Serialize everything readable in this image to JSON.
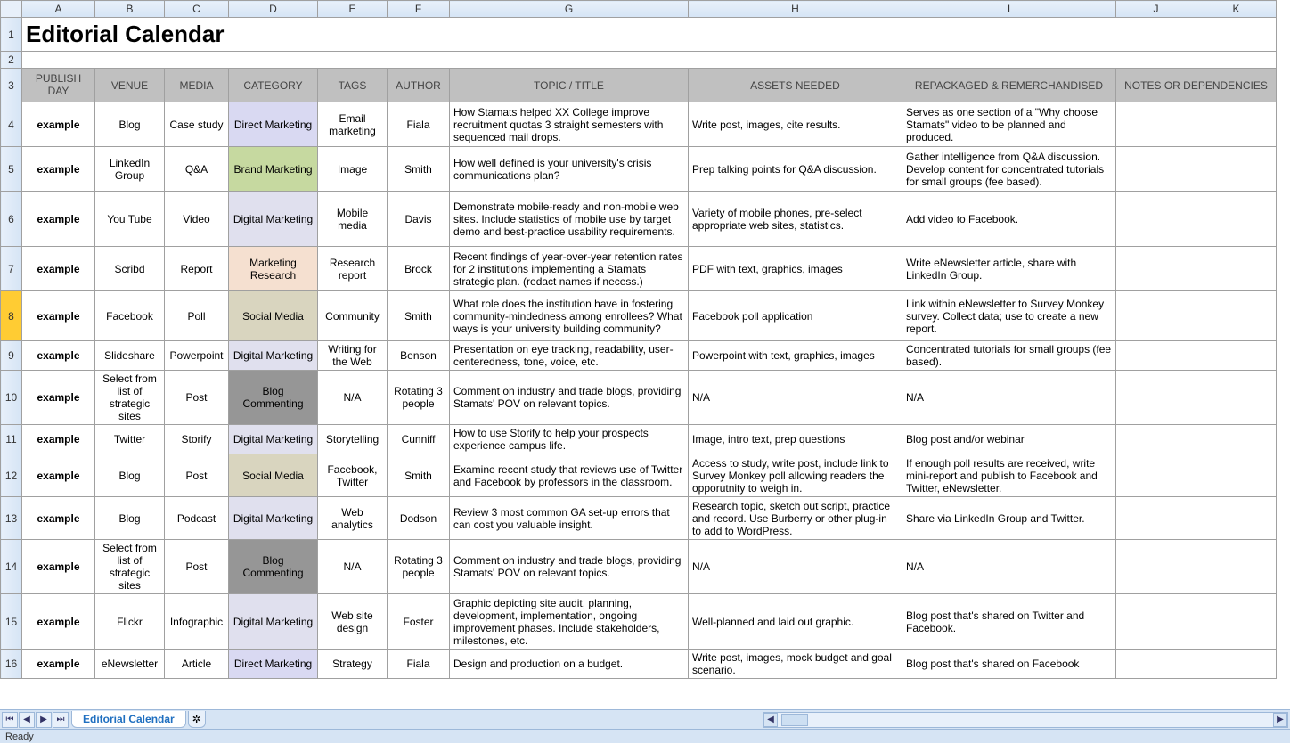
{
  "title": "Editorial Calendar",
  "col_letters": [
    "A",
    "B",
    "C",
    "D",
    "E",
    "F",
    "G",
    "H",
    "I",
    "J",
    "K"
  ],
  "row_numbers": [
    "1",
    "2",
    "3",
    "4",
    "5",
    "6",
    "7",
    "8",
    "9",
    "10",
    "11",
    "12",
    "13",
    "14",
    "15",
    "16"
  ],
  "headers": {
    "publish_day": "PUBLISH DAY",
    "venue": "VENUE",
    "media": "MEDIA",
    "category": "CATEGORY",
    "tags": "TAGS",
    "author": "AUTHOR",
    "topic": "TOPIC / TITLE",
    "assets": "ASSETS NEEDED",
    "repack": "REPACKAGED & REMERCHANDISED",
    "notes": "NOTES OR DEPENDENCIES"
  },
  "rows": [
    {
      "day": "example",
      "venue": "Blog",
      "media": "Case study",
      "category": "Direct Marketing",
      "catclass": "c-direct",
      "tags": "Email marketing",
      "author": "Fiala",
      "topic": "How Stamats helped XX College improve recruitment quotas 3 straight semesters with sequenced mail drops.",
      "assets": "Write post, images, cite results.",
      "repack": "Serves as one section of a \"Why choose Stamats\" video to be planned and produced.",
      "notes": "",
      "rh": "row-h4"
    },
    {
      "day": "example",
      "venue": "LinkedIn Group",
      "media": "Q&A",
      "category": "Brand Marketing",
      "catclass": "c-brand",
      "tags": "Image",
      "author": "Smith",
      "topic": "How well defined is your university's crisis communications plan?",
      "assets": "Prep talking points for Q&A discussion.",
      "repack": "Gather intelligence from Q&A discussion. Develop content for concentrated tutorials for small groups (fee based).",
      "notes": "",
      "rh": "row-h4"
    },
    {
      "day": "example",
      "venue": "You Tube",
      "media": "Video",
      "category": "Digital Marketing",
      "catclass": "c-digital",
      "tags": "Mobile media",
      "author": "Davis",
      "topic": "Demonstrate mobile-ready and non-mobile web sites. Include statistics of mobile use by target demo and best-practice usability requirements.",
      "assets": "Variety of mobile phones, pre-select appropriate web sites, statistics.",
      "repack": "Add video to Facebook.",
      "notes": "",
      "rh": "row-h5"
    },
    {
      "day": "example",
      "venue": "Scribd",
      "media": "Report",
      "category": "Marketing Research",
      "catclass": "c-research",
      "tags": "Research report",
      "author": "Brock",
      "topic": "Recent findings of year-over-year retention rates for 2 institutions implementing a Stamats strategic plan. (redact names if necess.)",
      "assets": "PDF with text, graphics, images",
      "repack": "Write eNewsletter article, share with LinkedIn Group.",
      "notes": "",
      "rh": "row-h4"
    },
    {
      "day": "example",
      "venue": "Facebook",
      "media": "Poll",
      "category": "Social Media",
      "catclass": "c-social",
      "tags": "Community",
      "author": "Smith",
      "topic": "What role does the institution have in fostering community-mindedness among enrollees? What ways is your university building community?",
      "assets": "Facebook poll application",
      "repack": "Link within eNewsletter to Survey Monkey survey. Collect data; use to create a new report.",
      "notes": "",
      "rh": "row-h6"
    },
    {
      "day": "example",
      "venue": "Slideshare",
      "media": "Powerpoint",
      "category": "Digital Marketing",
      "catclass": "c-digital",
      "tags": "Writing for the Web",
      "author": "Benson",
      "topic": "Presentation on eye tracking, readability, user-centeredness, tone, voice, etc.",
      "assets": "Powerpoint with text, graphics, images",
      "repack": "Concentrated tutorials for small groups (fee based).",
      "notes": "",
      "rh": "row-h2"
    },
    {
      "day": "example",
      "venue": "Select from list of strategic sites",
      "media": "Post",
      "category": "Blog Commenting",
      "catclass": "c-blogcom",
      "tags": "N/A",
      "author": "Rotating 3 people",
      "topic": "Comment on industry and trade blogs, providing Stamats' POV on relevant topics.",
      "assets": "N/A",
      "repack": "N/A",
      "notes": "",
      "rh": "row-h6"
    },
    {
      "day": "example",
      "venue": "Twitter",
      "media": "Storify",
      "category": "Digital Marketing",
      "catclass": "c-digital",
      "tags": "Storytelling",
      "author": "Cunniff",
      "topic": "How to use Storify to help your prospects experience campus life.",
      "assets": "Image, intro text, prep questions",
      "repack": "Blog post and/or webinar",
      "notes": "",
      "rh": "row-h2"
    },
    {
      "day": "example",
      "venue": "Blog",
      "media": "Post",
      "category": "Social Media",
      "catclass": "c-social",
      "tags": "Facebook, Twitter",
      "author": "Smith",
      "topic": "Examine recent study that reviews use of Twitter and Facebook by professors in the classroom.",
      "assets": "Access to study, write post, include link to Survey Monkey poll allowing readers the opporutnity to weigh in.",
      "repack": "If enough poll results are received, write mini-report and publish to Facebook and Twitter, eNewsletter.",
      "notes": "",
      "rh": "row-h3"
    },
    {
      "day": "example",
      "venue": "Blog",
      "media": "Podcast",
      "category": "Digital Marketing",
      "catclass": "c-digital",
      "tags": "Web analytics",
      "author": "Dodson",
      "topic": "Review 3 most common GA set-up errors that can cost you valuable insight.",
      "assets": "Research topic, sketch out script, practice and record. Use Burberry or other plug-in to add to WordPress.",
      "repack": "Share via LinkedIn Group and Twitter.",
      "notes": "",
      "rh": "row-h3"
    },
    {
      "day": "example",
      "venue": "Select from list of strategic sites",
      "media": "Post",
      "category": "Blog Commenting",
      "catclass": "c-blogcom",
      "tags": "N/A",
      "author": "Rotating 3 people",
      "topic": "Comment on industry and trade blogs, providing Stamats' POV on relevant topics.",
      "assets": "N/A",
      "repack": "N/A",
      "notes": "",
      "rh": "row-h6"
    },
    {
      "day": "example",
      "venue": "Flickr",
      "media": "Infographic",
      "category": "Digital Marketing",
      "catclass": "c-digital",
      "tags": "Web site design",
      "author": "Foster",
      "topic": "Graphic depicting site audit, planning, development, implementation, ongoing improvement phases. Include stakeholders, milestones, etc.",
      "assets": "Well-planned and laid out graphic.",
      "repack": "Blog post that's shared on Twitter and Facebook.",
      "notes": "",
      "rh": "row-h5"
    },
    {
      "day": "example",
      "venue": "eNewsletter",
      "media": "Article",
      "category": "Direct Marketing",
      "catclass": "c-direct",
      "tags": "Strategy",
      "author": "Fiala",
      "topic": "Design and production on a budget.",
      "assets": "Write post, images, mock budget and goal scenario.",
      "repack": "Blog post that's shared on Facebook",
      "notes": "",
      "rh": "row-h2"
    }
  ],
  "tab_name": "Editorial Calendar",
  "status": "Ready",
  "selected_row": 8
}
